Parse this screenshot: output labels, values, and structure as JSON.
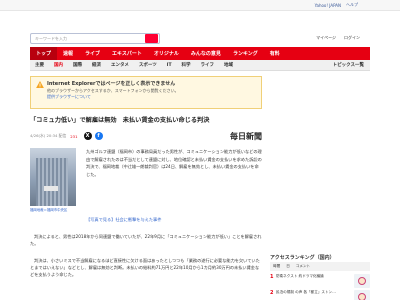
{
  "topbar": {
    "links": [
      "Yahoo! JAPAN",
      "ヘルプ"
    ]
  },
  "search": {
    "placeholder": "キーワードを入力"
  },
  "header": {
    "links": [
      "マイページ",
      "ログイン"
    ]
  },
  "main_nav": {
    "items": [
      "トップ",
      "速報",
      "ライブ",
      "エキスパート",
      "オリジナル",
      "みんなの意見",
      "ランキング",
      "有料"
    ],
    "active_index": 0
  },
  "sub_nav": {
    "items": [
      "主要",
      "国内",
      "国際",
      "経済",
      "エンタメ",
      "スポーツ",
      "IT",
      "科学",
      "ライフ",
      "地域"
    ],
    "active_index": 1,
    "topics": "トピックス一覧"
  },
  "notice": {
    "title": "Internet Explorerではページを正しく表示できません",
    "body": "他のブラウザーからアクセスするか、スマートフォンから閲覧ください。",
    "link": "提供ブラウザーについて"
  },
  "article": {
    "headline": "「コミュ力低い」で解雇は無効　未払い賃金の支払い命じる判決",
    "date": "4/26(水) 20:34 配信",
    "comments": "231",
    "publisher": "毎日新聞",
    "photo_caption": "福岡地裁＝福岡市中央区",
    "lead": "九州ゴルフ連盟（福岡市）の事務局員だった男性が、コミュニケーション能力が低いなどの理由で解雇されたのは不当だとして連盟に対し、地位確認と未払い賃金の支払いを求めた訴訟の判決で、福岡地裁（中辻雄一朗裁判官）は24日、解雇を無効とし、未払い賃金の支払いを命じた。",
    "related": "【写真で見る】社会に衝撃を与えた事件",
    "para1": "判決によると、男性は2018年から同連盟で働いていたが、22年9月に「コミュニケーション能力が低い」ことを解雇された。",
    "para2": "判決は、小さいミスで不当解雇になるほど直接性に欠ける面はあったとしつつも「業務の遂行に必要な能力を欠いていたとまではいえない」などとし、解雇は無効と判断。未払いの給料約71万円と22年10月から1カ月約30万円の未払い賃金などを支払うよう命じた。"
  },
  "ranking": {
    "title": "アクセスランキング（国内）",
    "tabs": [
      "時間",
      "日",
      "コメント"
    ],
    "items": [
      {
        "rank": "1",
        "text": "防衛ネクスト 約ドラマ化議論"
      },
      {
        "rank": "2",
        "text": "民泊の規制 の声 各「都立」ストン…"
      }
    ]
  },
  "colors": {
    "brand_red": "#e60012",
    "link_blue": "#3366cc",
    "notice_bg": "#fff8e1"
  }
}
